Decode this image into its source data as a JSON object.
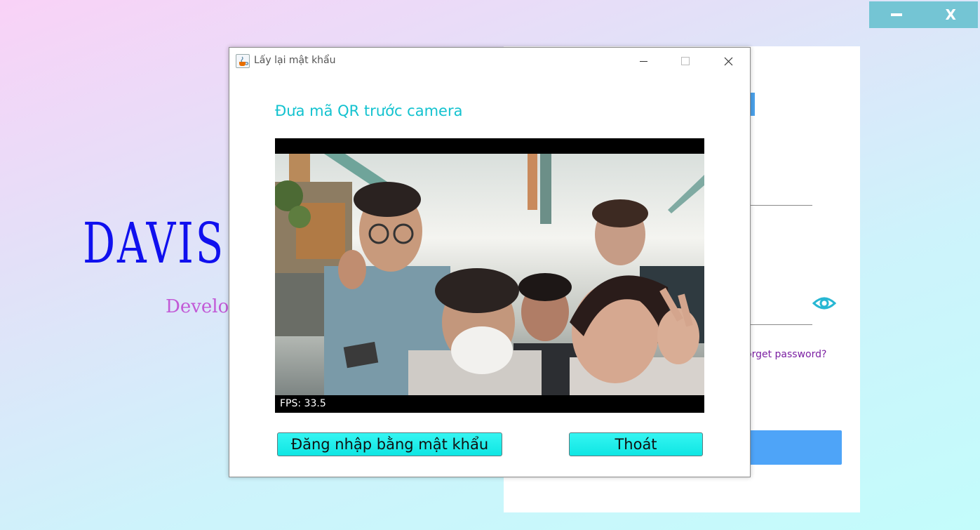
{
  "app_window": {
    "controls": {
      "minimize_icon": "minimize-icon",
      "close_label": "X"
    }
  },
  "background": {
    "brand_title": "DAVIS",
    "brand_subtitle": "Develo",
    "login_panel": {
      "forgot_password_link": "orget password?",
      "eye_icon": "eye-icon",
      "accent_color": "#4ea4f8"
    }
  },
  "dialog": {
    "window_title": "Lấy lại mật khẩu",
    "heading": "Đưa mã QR trước camera",
    "camera": {
      "fps_label": "FPS: 33.5"
    },
    "buttons": {
      "password_login": "Đăng nhập bằng mật khẩu",
      "exit": "Thoát"
    },
    "colors": {
      "heading": "#13c2cf",
      "button": "#1de9e6"
    }
  }
}
